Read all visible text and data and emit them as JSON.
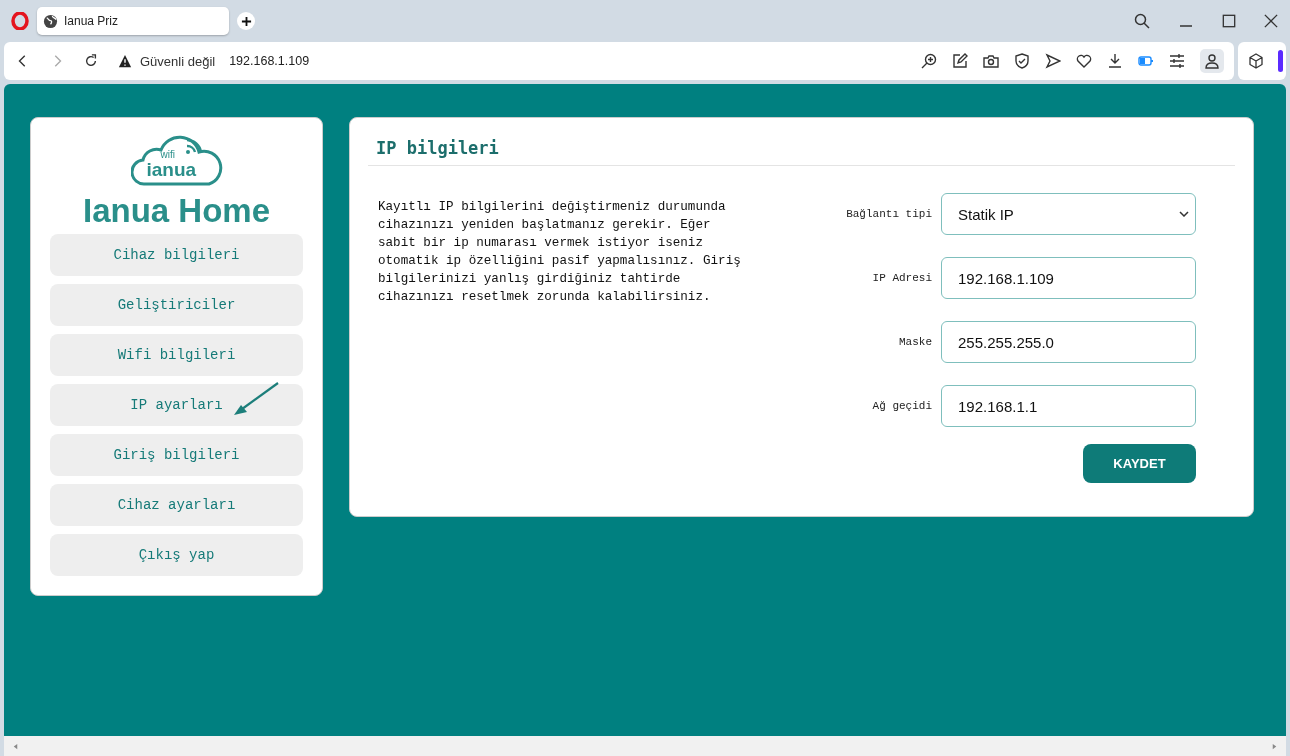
{
  "browser": {
    "tab_title": "Ianua Priz",
    "security_label": "Güvenli değil",
    "address": "192.168.1.109"
  },
  "sidebar": {
    "logo_text_small": "wifi",
    "logo_text": "ianua",
    "title": "Ianua Home",
    "items": [
      {
        "label": "Cihaz bilgileri"
      },
      {
        "label": "Geliştiriciler"
      },
      {
        "label": "Wifi bilgileri"
      },
      {
        "label": "IP ayarları"
      },
      {
        "label": "Giriş bilgileri"
      },
      {
        "label": "Cihaz ayarları"
      },
      {
        "label": "Çıkış yap"
      }
    ]
  },
  "panel": {
    "title": "IP bilgileri",
    "description": "Kayıtlı IP bilgilerini değiştirmeniz durumunda cihazınızı yeniden başlatmanız gerekir. Eğer sabit bir ip numarası vermek istiyor iseniz otomatik ip özelliğini pasif yapmalısınız. Giriş bilgilerinizi yanlış girdiğiniz tahtirde cihazınızı resetlmek zorunda kalabilirsiniz.",
    "fields": [
      {
        "kind": "select",
        "label": "Bağlantı tipi",
        "value": "Statik IP"
      },
      {
        "kind": "text",
        "label": "IP Adresi",
        "value": "192.168.1.109"
      },
      {
        "kind": "text",
        "label": "Maske",
        "value": "255.255.255.0"
      },
      {
        "kind": "text",
        "label": "Ağ geçidi",
        "value": "192.168.1.1"
      }
    ],
    "save_button": "KAYDET"
  }
}
